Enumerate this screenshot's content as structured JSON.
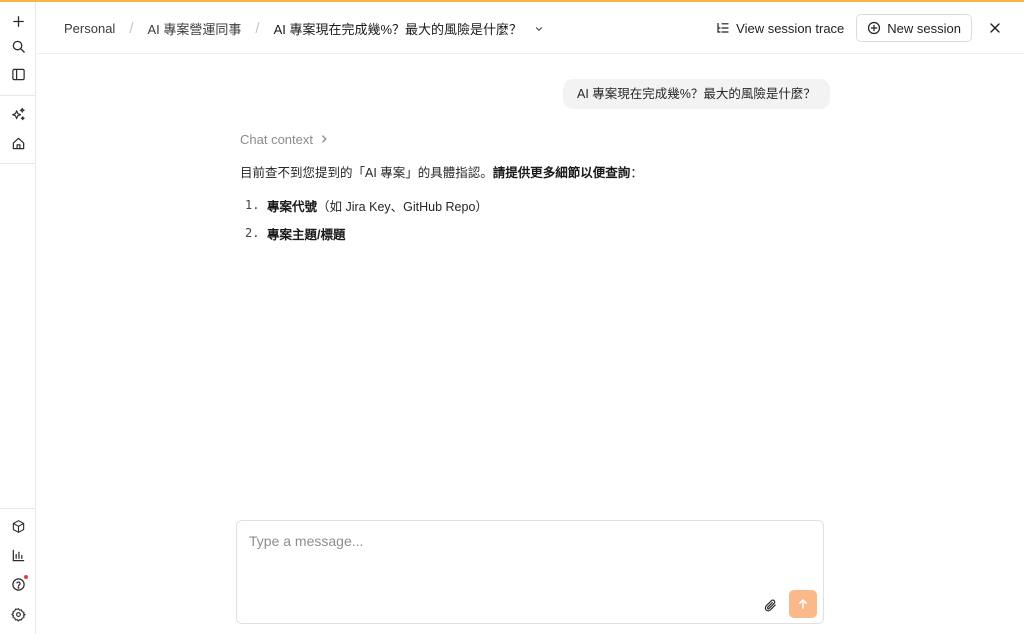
{
  "colors": {
    "accent_bar": "#f5b547",
    "send_button": "#f9b98a",
    "notification_dot": "#e0403a"
  },
  "rail": {
    "top_icons": [
      "plus-icon",
      "search-icon",
      "sidebar-toggle-icon",
      "sparkles-icon",
      "home-icon"
    ],
    "bottom_icons": [
      "cube-icon",
      "bar-chart-icon",
      "help-icon",
      "gear-icon"
    ]
  },
  "breadcrumb": {
    "items": [
      "Personal",
      "AI 專案營運同事",
      "AI 專案現在完成幾%？最大的風險是什麼？"
    ],
    "separator": "/"
  },
  "header": {
    "view_trace_label": "View session trace",
    "new_session_label": "New session"
  },
  "chat": {
    "user_message": "AI 專案現在完成幾%？最大的風險是什麼？",
    "context_label": "Chat context",
    "assistant": {
      "intro_prefix": "目前查不到您提到的「AI 專案」的具體指認。",
      "intro_bold": "請提供更多細節以便查詢",
      "intro_suffix": "：",
      "list": [
        {
          "num": "1.",
          "bold": "專案代號",
          "rest": "（如 Jira Key、GitHub Repo）"
        },
        {
          "num": "2.",
          "bold": "專案主題/標題",
          "rest": ""
        }
      ]
    }
  },
  "composer": {
    "placeholder": "Type a message..."
  }
}
